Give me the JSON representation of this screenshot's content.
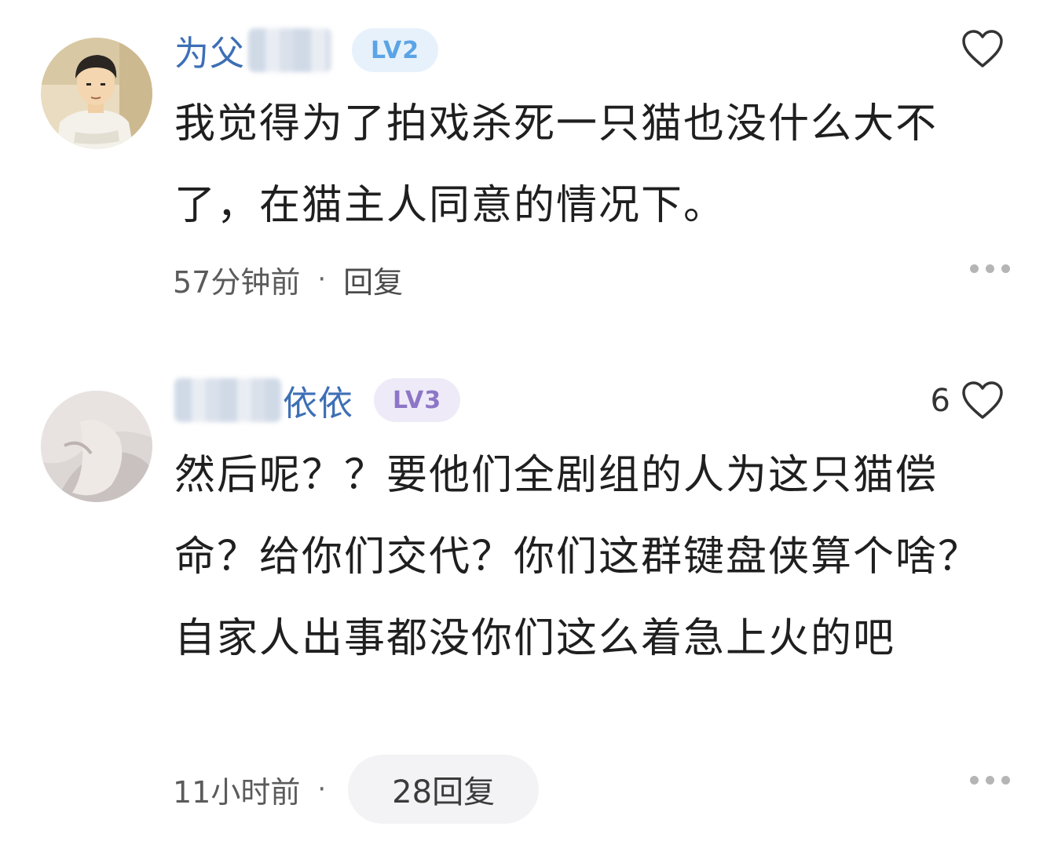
{
  "comments": [
    {
      "username": "为父",
      "level": "LV2",
      "like_count": "",
      "text": "我觉得为了拍戏杀死一只猫也没什么大不了，在猫主人同意的情况下。",
      "time": "57分钟前",
      "separator": "·",
      "reply_label": "回复",
      "heart_icon": "heart-outline-icon",
      "more_icon": "more-dots-icon"
    },
    {
      "username": "依依",
      "level": "LV3",
      "like_count": "6",
      "text": "然后呢？？要他们全剧组的人为这只猫偿命？给你们交代？你们这群键盘侠算个啥？自家人出事都没你们这么着急上火的吧",
      "time": "11小时前",
      "separator": "·",
      "reply_label": "28回复",
      "heart_icon": "heart-outline-icon",
      "more_icon": "more-dots-icon"
    }
  ],
  "colors": {
    "username": "#3d6fb5",
    "lv2_bg": "#e7f1fb",
    "lv2_text": "#5aa4e6",
    "lv3_bg": "#efeaf8",
    "lv3_text": "#8d76c6",
    "body_text": "#1f1f1f",
    "meta_text": "#5b5b5b"
  }
}
